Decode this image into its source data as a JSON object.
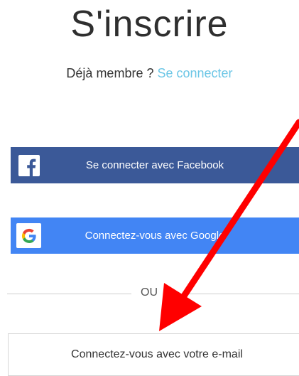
{
  "header": {
    "title": "S'inscrire"
  },
  "login_prompt": {
    "text": "Déjà membre ?",
    "link": "Se connecter"
  },
  "facebook_button": {
    "label": "Se connecter avec Facebook",
    "icon": "facebook-icon",
    "color": "#3b5998"
  },
  "google_button": {
    "label": "Connectez-vous avec Google",
    "icon": "google-icon",
    "color": "#4285f4"
  },
  "separator": {
    "text": "OU"
  },
  "email_button": {
    "label": "Connectez-vous avec votre e-mail"
  },
  "annotation": {
    "arrow_color": "#ff0000"
  }
}
